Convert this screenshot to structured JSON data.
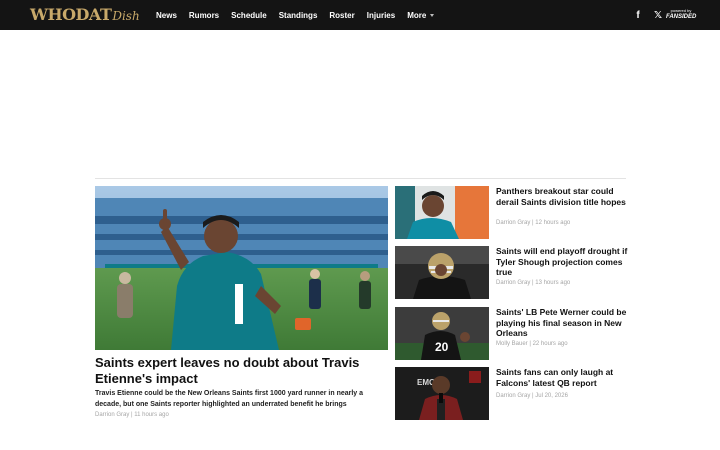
{
  "header": {
    "logo_main": "WHODAT",
    "logo_sub": "Dish",
    "nav": [
      "News",
      "Rumors",
      "Schedule",
      "Standings",
      "Roster",
      "Injuries"
    ],
    "more_label": "More",
    "facebook_glyph": "f",
    "x_glyph": "𝕏",
    "powered_by": "powered by",
    "powered_brand": "FANSIDED"
  },
  "hero": {
    "title": "Saints expert leaves no doubt about Travis Etienne's impact",
    "summary": "Travis Etienne could be the New Orleans Saints first 1000 yard runner in nearly a decade, but one Saints reporter highlighted an underrated benefit he brings",
    "meta": "Darrion Gray | 11 hours ago",
    "image": "jaguars player in teal jersey pointing up in stadium"
  },
  "stories": [
    {
      "title": "Panthers breakout star could derail Saints division title hopes",
      "meta": "Darrion Gray | 12 hours ago",
      "image": "young player in teal jersey"
    },
    {
      "title": "Saints will end playoff drought if Tyler Shough projection comes true",
      "meta": "Darrion Gray | 13 hours ago",
      "image": "saints quarterback with helmet"
    },
    {
      "title": "Saints' LB Pete Werner could be playing his final season in New Orleans",
      "meta": "Molly Bauer | 22 hours ago",
      "image": "saints linebacker number 20"
    },
    {
      "title": "Saints fans can only laugh at Falcons' latest QB report",
      "meta": "Darrion Gray | Jul 20, 2026",
      "image": "falcons coach at press podium"
    }
  ],
  "icons": {
    "facebook": "facebook-icon",
    "x": "x-icon",
    "more": "chevron-down-icon"
  },
  "colors": {
    "topbar": "#141414",
    "logo_gold": "#c8a96a",
    "meta_gray": "#a5a5a5",
    "jaguars_teal": "#0e7b88"
  }
}
